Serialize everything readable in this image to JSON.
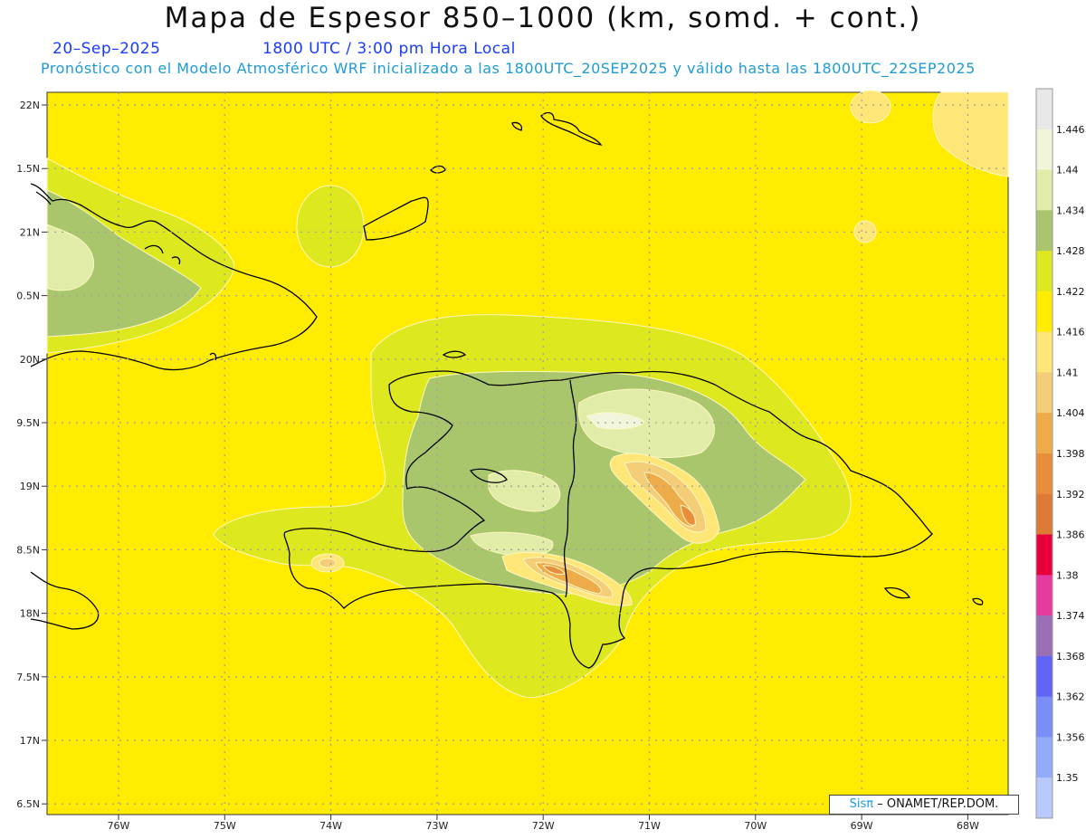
{
  "title": "Mapa de Espesor 850–1000 (km, somd. + cont.)",
  "date": "20–Sep–2025",
  "time": "1800 UTC / 3:00 pm Hora Local",
  "forecast_line": "Pronóstico con el Modelo Atmosférico WRF inicializado a las 1800UTC_20SEP2025 y válido hasta las  1800UTC_22SEP2025",
  "lat_labels": [
    "22N",
    "1.5N",
    "21N",
    "0.5N",
    "20N",
    "9.5N",
    "19N",
    "8.5N",
    "18N",
    "7.5N",
    "17N",
    "6.5N"
  ],
  "lon_labels": [
    "76W",
    "75W",
    "74W",
    "73W",
    "72W",
    "71W",
    "70W",
    "69W",
    "68W"
  ],
  "colorbar": {
    "labels": [
      "1.446",
      "1.44",
      "1.434",
      "1.428",
      "1.422",
      "1.416",
      "1.41",
      "1.404",
      "1.398",
      "1.392",
      "1.386",
      "1.38",
      "1.374",
      "1.368",
      "1.362",
      "1.356",
      "1.35"
    ],
    "colors": [
      "#e8e8e8",
      "#f1f5dc",
      "#e0eca8",
      "#a9c66d",
      "#dde81e",
      "#ffec00",
      "#ffe678",
      "#f3cd78",
      "#eeab4a",
      "#e88e3a",
      "#dd7a36",
      "#e8003c",
      "#e63aa0",
      "#9b6fb5",
      "#6363f5",
      "#7b8df7",
      "#93abf9",
      "#b9c9fb"
    ]
  },
  "fill_colors": {
    "background": "#ffec00",
    "band_1422": "#dde81e",
    "band_1428": "#a9c66d",
    "band_1434": "#e0eca8",
    "band_1440": "#f1f5dc",
    "band_1410": "#ffe678",
    "band_1404": "#f3cd78",
    "band_1398": "#eeab4a",
    "band_1392": "#e88e3a"
  },
  "credit": {
    "logo": "Sisπ",
    "text": "– ONAMET/REP.DOM."
  }
}
